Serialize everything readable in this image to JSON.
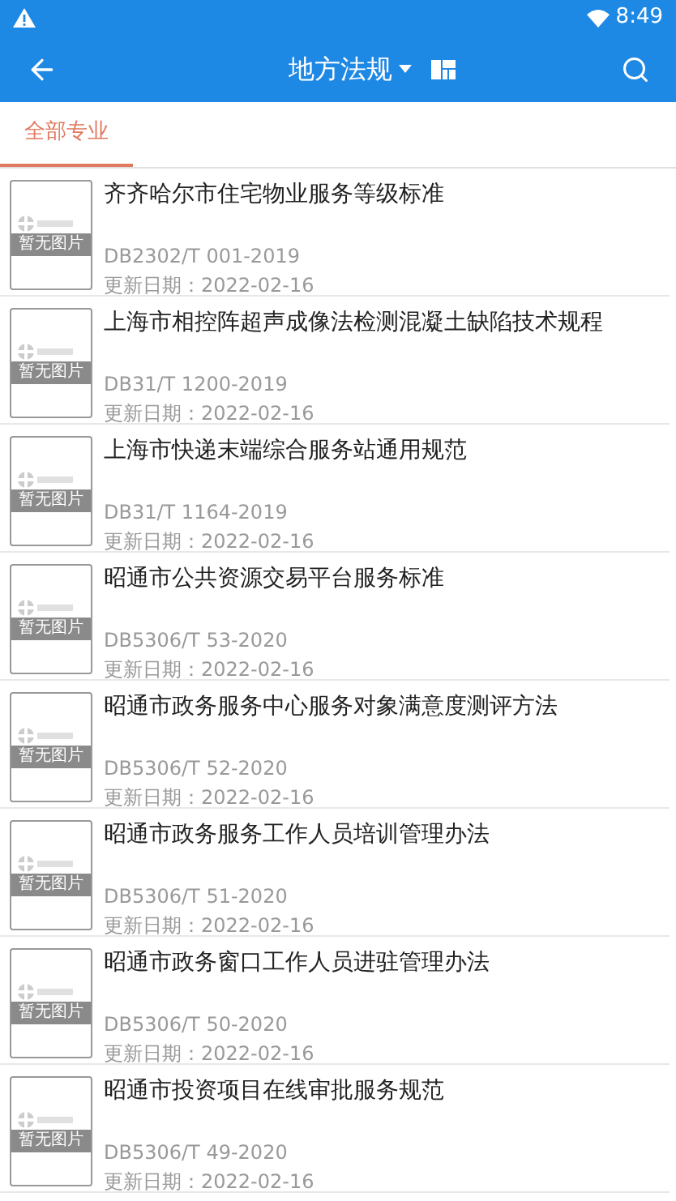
{
  "status_bar": {
    "time": "8:49"
  },
  "toolbar": {
    "title": "地方法规"
  },
  "tabs": [
    {
      "label": "全部专业",
      "selected": true
    }
  ],
  "items": [
    {
      "title": "齐齐哈尔市住宅物业服务等级标准",
      "code": "DB2302/T 001-2019",
      "date": "更新日期：2022-02-16",
      "thumbnail_text": "暂无图片"
    },
    {
      "title": "上海市相控阵超声成像法检测混凝土缺陷技术规程",
      "code": "DB31/T 1200-2019",
      "date": "更新日期：2022-02-16",
      "thumbnail_text": "暂无图片"
    },
    {
      "title": "上海市快递末端综合服务站通用规范",
      "code": "DB31/T 1164-2019",
      "date": "更新日期：2022-02-16",
      "thumbnail_text": "暂无图片"
    },
    {
      "title": "昭通市公共资源交易平台服务标准",
      "code": "DB5306/T 53-2020",
      "date": "更新日期：2022-02-16",
      "thumbnail_text": "暂无图片"
    },
    {
      "title": "昭通市政务服务中心服务对象满意度测评方法",
      "code": "DB5306/T 52-2020",
      "date": "更新日期：2022-02-16",
      "thumbnail_text": "暂无图片"
    },
    {
      "title": "昭通市政务服务工作人员培训管理办法",
      "code": "DB5306/T 51-2020",
      "date": "更新日期：2022-02-16",
      "thumbnail_text": "暂无图片"
    },
    {
      "title": "昭通市政务窗口工作人员进驻管理办法",
      "code": "DB5306/T 50-2020",
      "date": "更新日期：2022-02-16",
      "thumbnail_text": "暂无图片"
    },
    {
      "title": "昭通市投资项目在线审批服务规范",
      "code": "DB5306/T 49-2020",
      "date": "更新日期：2022-02-16",
      "thumbnail_text": "暂无图片"
    }
  ]
}
